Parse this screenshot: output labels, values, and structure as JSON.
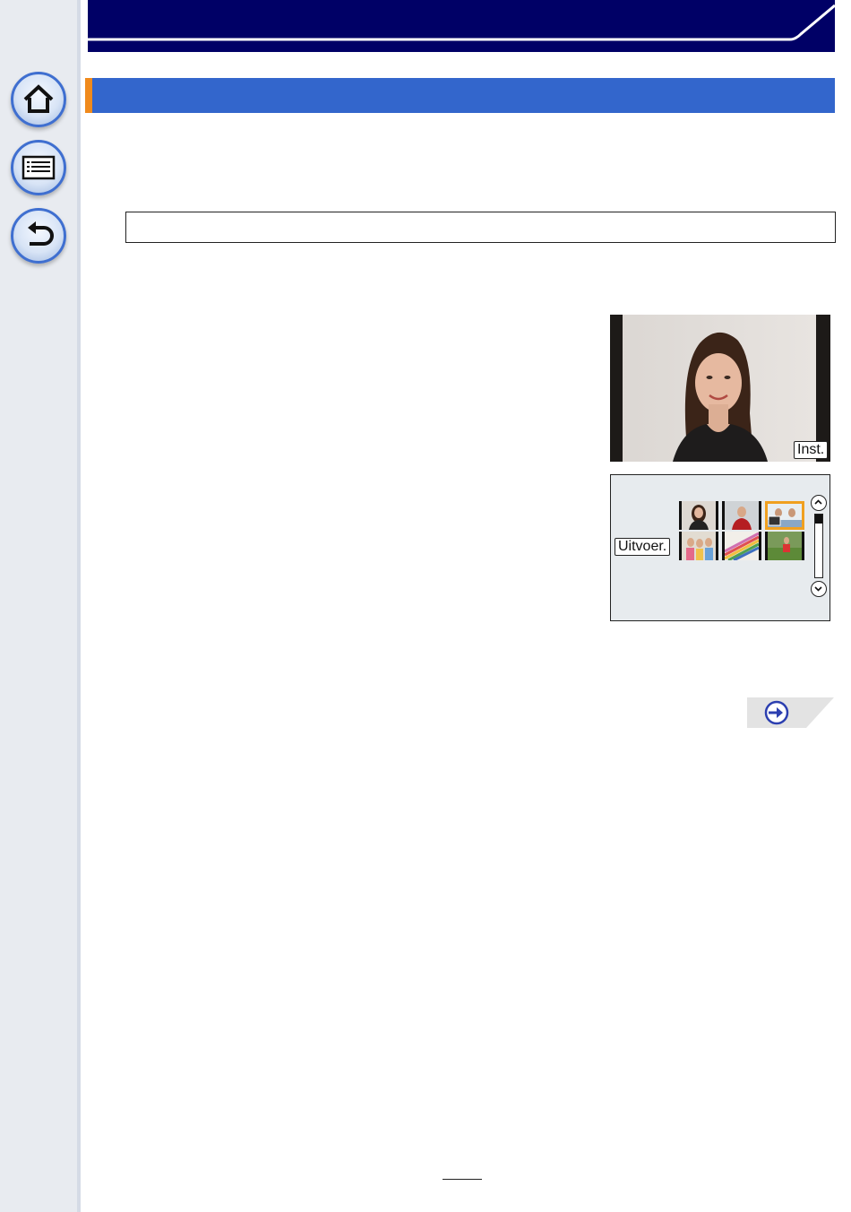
{
  "sidebar": {
    "home_icon": "home-icon",
    "menu_icon": "list-icon",
    "back_icon": "return-arrow-icon"
  },
  "colors": {
    "header_navy": "#000066",
    "section_blue": "#3366cc",
    "accent_orange": "#f08a1c",
    "nav_ring": "#3f6fd0"
  },
  "photo_panel": {
    "set_button_label": "Inst."
  },
  "thumb_panel": {
    "execute_button_label": "Uitvoer.",
    "scroll_up_icon": "chevron-up-icon",
    "scroll_down_icon": "chevron-down-icon"
  },
  "next_page_icon": "arrow-right-icon"
}
